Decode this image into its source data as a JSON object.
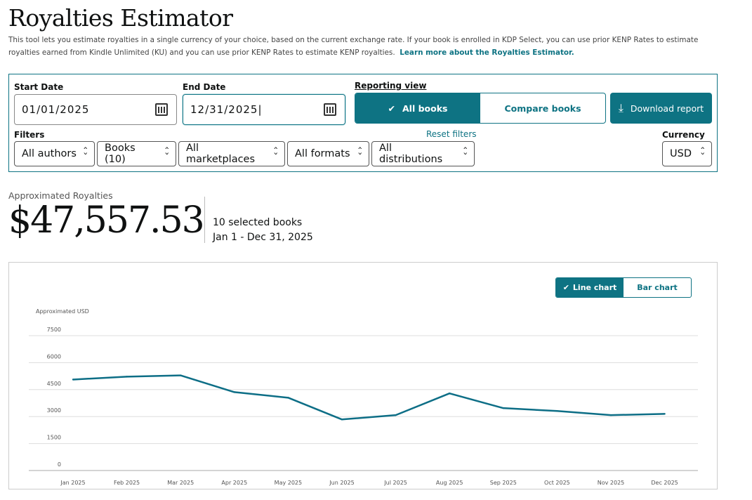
{
  "title": "Royalties Estimator",
  "intro": "This tool lets you estimate royalties in a single currency of your choice, based on the current exchange rate. If your book is enrolled in KDP Select, you can use prior KENP Rates to estimate royalties earned from Kindle Unlimited (KU) and you can use prior KENP Rates to estimate KENP royalties.",
  "learn_more": "Learn more about the Royalties Estimator.",
  "filters_panel": {
    "start_label": "Start Date",
    "start_value": "01/01/2025",
    "end_label": "End Date",
    "end_value": "12/31/2025",
    "reporting_label": "Reporting view",
    "all_books": "All books",
    "compare_books": "Compare books",
    "download": "Download report",
    "filters_label": "Filters",
    "reset": "Reset filters",
    "selects": [
      "All authors",
      "Books (10)",
      "All marketplaces",
      "All formats",
      "All distributions"
    ],
    "currency_label": "Currency",
    "currency": "USD"
  },
  "summary": {
    "label": "Approximated Royalties",
    "amount": "$47,557.53",
    "books": "10 selected books",
    "range": "Jan 1 - Dec 31, 2025"
  },
  "chart_toggle": {
    "line": "Line chart",
    "bar": "Bar chart"
  },
  "colors": {
    "accent": "#0e7383",
    "line": "#0d6e86"
  },
  "chart_data": {
    "type": "line",
    "ylabel": "Approximated USD",
    "ylim": [
      0,
      7500
    ],
    "yticks": [
      7500,
      6000,
      4500,
      3000,
      1500,
      0
    ],
    "grid": true,
    "categories": [
      "Jan 2025",
      "Feb 2025",
      "Mar 2025",
      "Apr 2025",
      "May 2025",
      "Jun 2025",
      "Jul 2025",
      "Aug 2025",
      "Sep 2025",
      "Oct 2025",
      "Nov 2025",
      "Dec 2025"
    ],
    "series": [
      {
        "name": "Approximated Royalties",
        "values": [
          5060,
          5220,
          5290,
          4360,
          4050,
          2840,
          3080,
          4290,
          3470,
          3310,
          3080,
          3150
        ]
      }
    ]
  }
}
